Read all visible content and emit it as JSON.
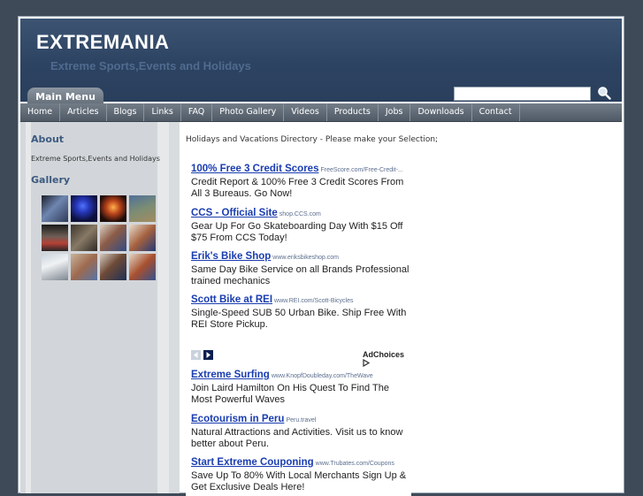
{
  "header": {
    "title": "EXTREMANIA",
    "tagline": "Extreme Sports,Events and Holidays",
    "menu_tab": "Main Menu"
  },
  "search": {
    "value": ""
  },
  "nav": [
    "Home",
    "Articles",
    "Blogs",
    "Links",
    "FAQ",
    "Photo Gallery",
    "Videos",
    "Products",
    "Jobs",
    "Downloads",
    "Contact"
  ],
  "sidebar": {
    "about_heading": "About",
    "about_text": "Extreme Sports,Events and Holidays",
    "gallery_heading": "Gallery"
  },
  "main": {
    "intro": "Holidays and Vacations Directory - Please make your Selection;"
  },
  "ads": [
    {
      "title": "100% Free 3 Credit Scores",
      "url": "FreeScore.com/Free-Credit-...",
      "desc": "Credit Report & 100% Free 3 Credit Scores From All 3 Bureaus. Go Now!"
    },
    {
      "title": "CCS - Official Site",
      "url": "shop.CCS.com",
      "desc": "Gear Up For Go Skateboarding Day With $15 Off $75 From CCS Today!"
    },
    {
      "title": "Erik's Bike Shop",
      "url": "www.eriksbikeshop.com",
      "desc": "Same Day Bike Service on all Brands Professional trained mechanics"
    },
    {
      "title": "Scott Bike at REI",
      "url": "www.REI.com/Scott-Bicycles",
      "desc": "Single-Speed SUB 50 Urban Bike. Ship Free With REI Store Pickup."
    },
    {
      "title": "Extreme Surfing",
      "url": "www.KnopfDoubleday.com/TheWave",
      "desc": "Join Laird Hamilton On His Quest To Find The Most Powerful Waves"
    },
    {
      "title": "Ecotourism in Peru",
      "url": "Peru.travel",
      "desc": "Natural Attractions and Activities. Visit us to know better about Peru."
    },
    {
      "title": "Start Extreme Couponing",
      "url": "www.Trubates.com/Coupons",
      "desc": "Save Up To 80% With Local Merchants Sign Up & Get Exclusive Deals Here!"
    }
  ],
  "adchoices_label": "AdChoices",
  "colors": {
    "page_bg": "#3e4a57",
    "header_bg": "#2d4362",
    "tagline": "#4f6b8f",
    "heading": "#3d5a80",
    "ad_link": "#1a3db0"
  },
  "icons": {
    "search": "magnifier-icon",
    "prev": "arrow-left-icon",
    "next": "arrow-right-icon",
    "adchoices": "adchoices-triangle-icon"
  }
}
